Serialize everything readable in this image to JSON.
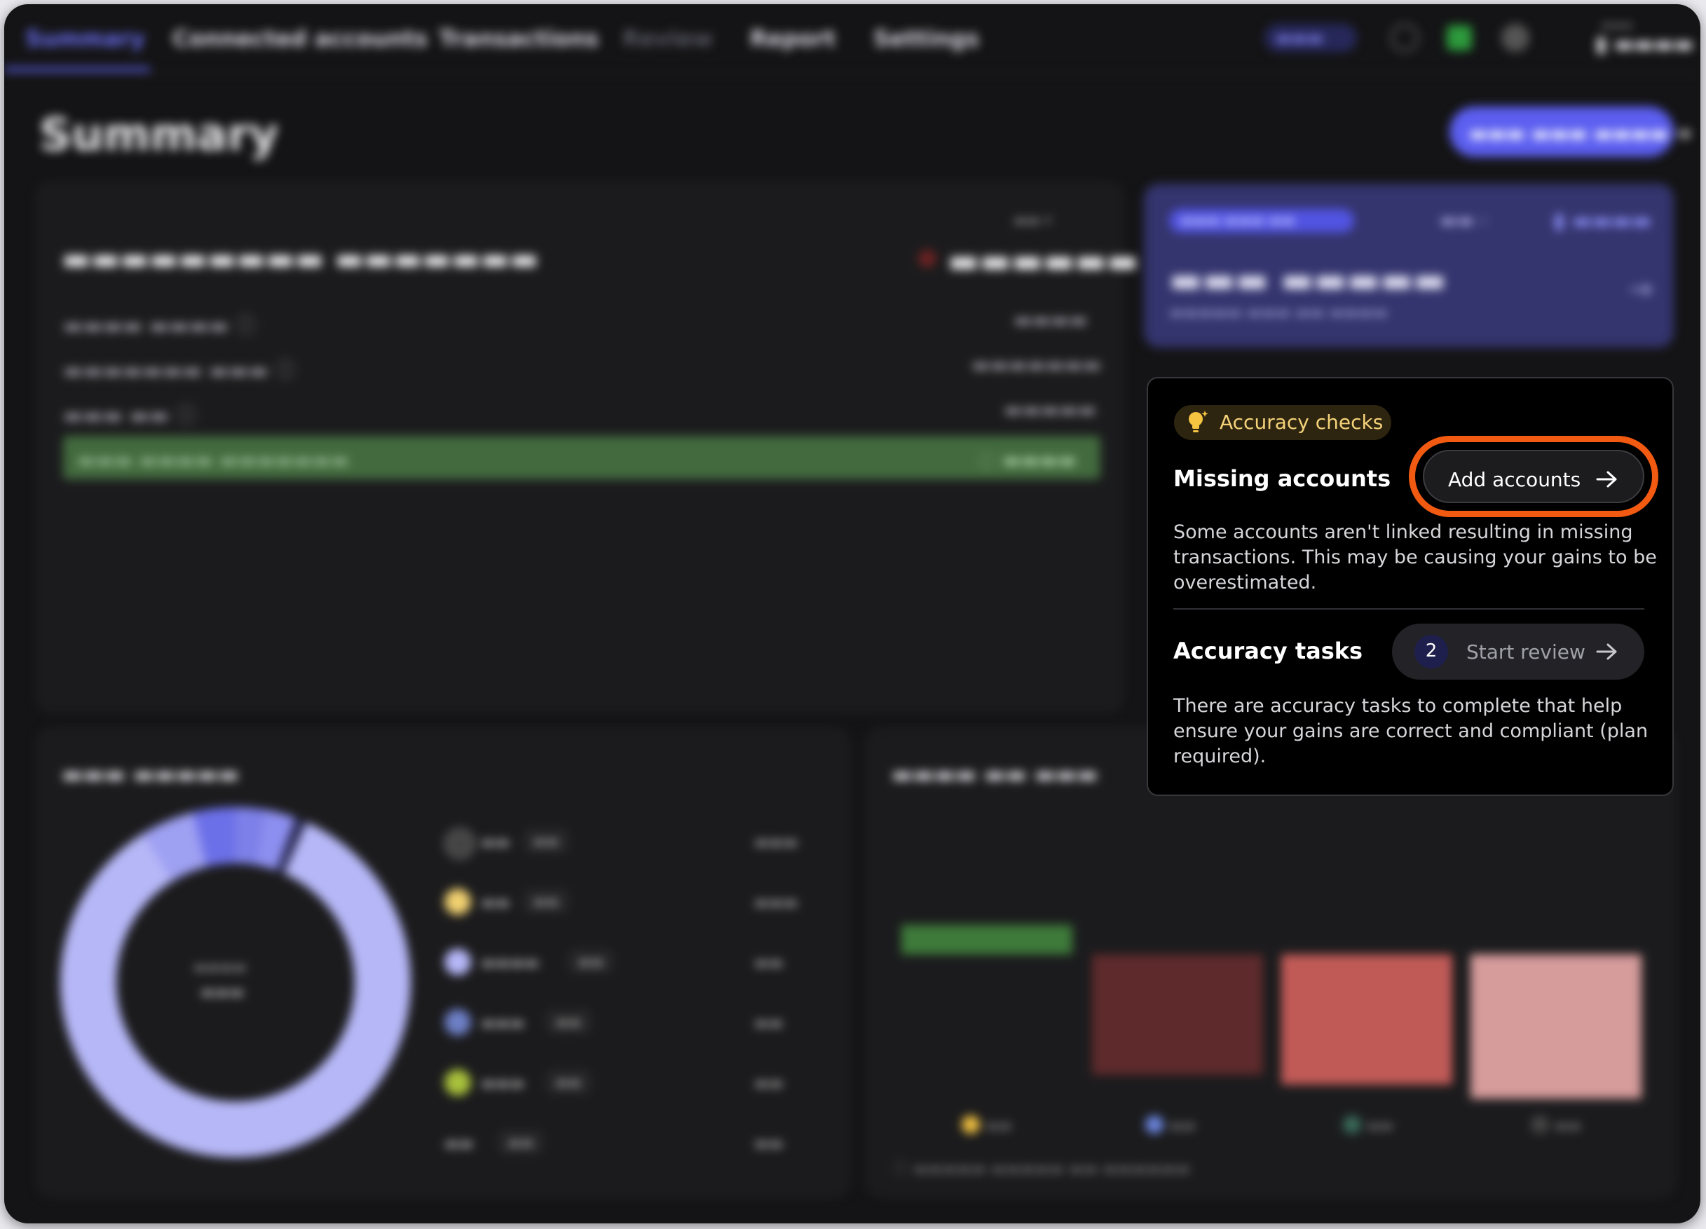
{
  "nav": {
    "tabs": [
      {
        "label": "Summary"
      },
      {
        "label": "Connected accounts"
      },
      {
        "label": "Transactions"
      },
      {
        "label": "Review"
      },
      {
        "label": "Report"
      },
      {
        "label": "Settings"
      }
    ],
    "active_tab": "Summary"
  },
  "page": {
    "title": "Summary"
  },
  "accuracy_checks": {
    "badge_label": "Accuracy checks",
    "missing_accounts": {
      "title": "Missing accounts",
      "button_label": "Add accounts",
      "description": "Some accounts aren't linked resulting in missing transactions. This may be causing your gains to be overestimated."
    },
    "accuracy_tasks": {
      "title": "Accuracy tasks",
      "count": "2",
      "button_label": "Start review",
      "description": "There are accuracy tasks to complete that help ensure your gains are correct and compliant (plan required)."
    }
  },
  "colors": {
    "highlight": "#f25a11",
    "accent": "#5c5ff0",
    "badge_text": "#f4d27a"
  },
  "icons": {
    "badge": "lightbulb-icon",
    "add_button": "arrow-right-icon",
    "review_button": "arrow-right-icon"
  }
}
